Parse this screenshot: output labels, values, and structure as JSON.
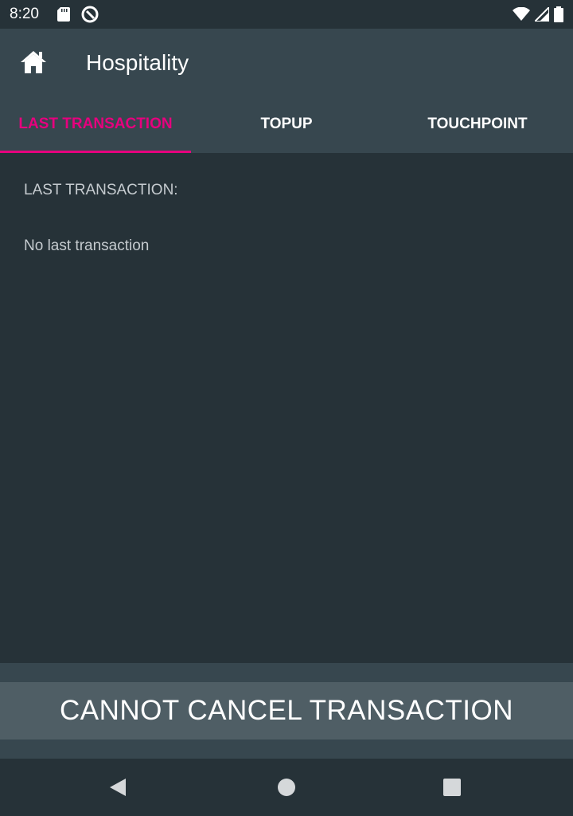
{
  "status_bar": {
    "time": "8:20",
    "icons": [
      "sd-card-icon",
      "q-icon",
      "wifi-icon",
      "signal-icon",
      "battery-icon"
    ]
  },
  "app_bar": {
    "title": "Hospitality",
    "home_icon": "home-icon"
  },
  "tabs": [
    {
      "label": "LAST TRANSACTION",
      "active": true
    },
    {
      "label": "TOPUP",
      "active": false
    },
    {
      "label": "TOUCHPOINT",
      "active": false
    }
  ],
  "content": {
    "section_label": "LAST TRANSACTION:",
    "empty_text": "No last transaction"
  },
  "action": {
    "button_label": "CANNOT CANCEL TRANSACTION"
  },
  "nav": {
    "icons": [
      "back-icon",
      "home-circle-icon",
      "recent-apps-icon"
    ]
  },
  "colors": {
    "accent": "#e6007e",
    "app_bar": "#37474f",
    "background": "#263238",
    "button": "#4f5e65"
  }
}
